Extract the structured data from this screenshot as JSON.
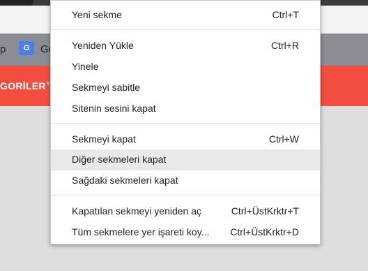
{
  "background": {
    "bookmark_partial_left": "p",
    "bookmark_icon_glyph": "G",
    "bookmark_partial_text": "Go",
    "nav_label_partial": "GORİLER",
    "nav_chevron": "˅",
    "accent_color": "#f24e3f"
  },
  "menu": {
    "new_tab": {
      "label": "Yeni sekme",
      "shortcut": "Ctrl+T"
    },
    "reload": {
      "label": "Yeniden Yükle",
      "shortcut": "Ctrl+R"
    },
    "duplicate": {
      "label": "Yinele"
    },
    "pin": {
      "label": "Sekmeyi sabitle"
    },
    "mute": {
      "label": "Sitenin sesini kapat"
    },
    "close": {
      "label": "Sekmeyi kapat",
      "shortcut": "Ctrl+W"
    },
    "close_others": {
      "label": "Diğer sekmeleri kapat"
    },
    "close_right": {
      "label": "Sağdaki sekmeleri kapat"
    },
    "reopen": {
      "label": "Kapatılan sekmeyi yeniden aç",
      "shortcut": "Ctrl+ÜstKrktr+T"
    },
    "bookmark_all": {
      "label": "Tüm sekmelere yer işareti koy...",
      "shortcut": "Ctrl+ÜstKrktr+D"
    }
  }
}
